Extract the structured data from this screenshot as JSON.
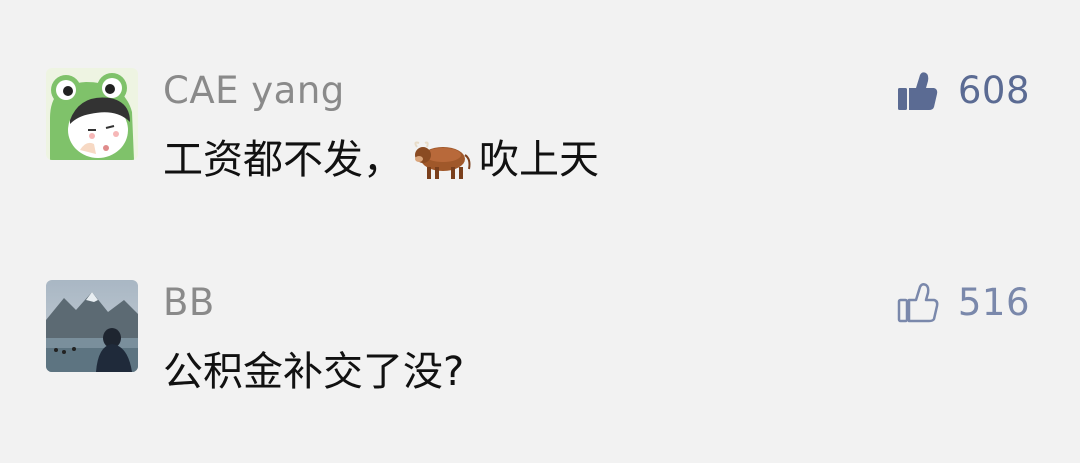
{
  "colors": {
    "background": "#f2f2f2",
    "username": "#8a8a8a",
    "text": "#111111",
    "like_active": "#5b6b93",
    "like_inactive": "#7a88ab"
  },
  "comments": [
    {
      "username": "CAE yang",
      "text_before": "工资都不发，",
      "emoji": "ox-emoji",
      "text_after": "吹上天",
      "like_count": "608",
      "liked": true,
      "avatar": "frog-hat-avatar"
    },
    {
      "username": "BB",
      "text": "公积金补交了没?",
      "like_count": "516",
      "liked": false,
      "avatar": "mountain-photo-avatar"
    }
  ]
}
